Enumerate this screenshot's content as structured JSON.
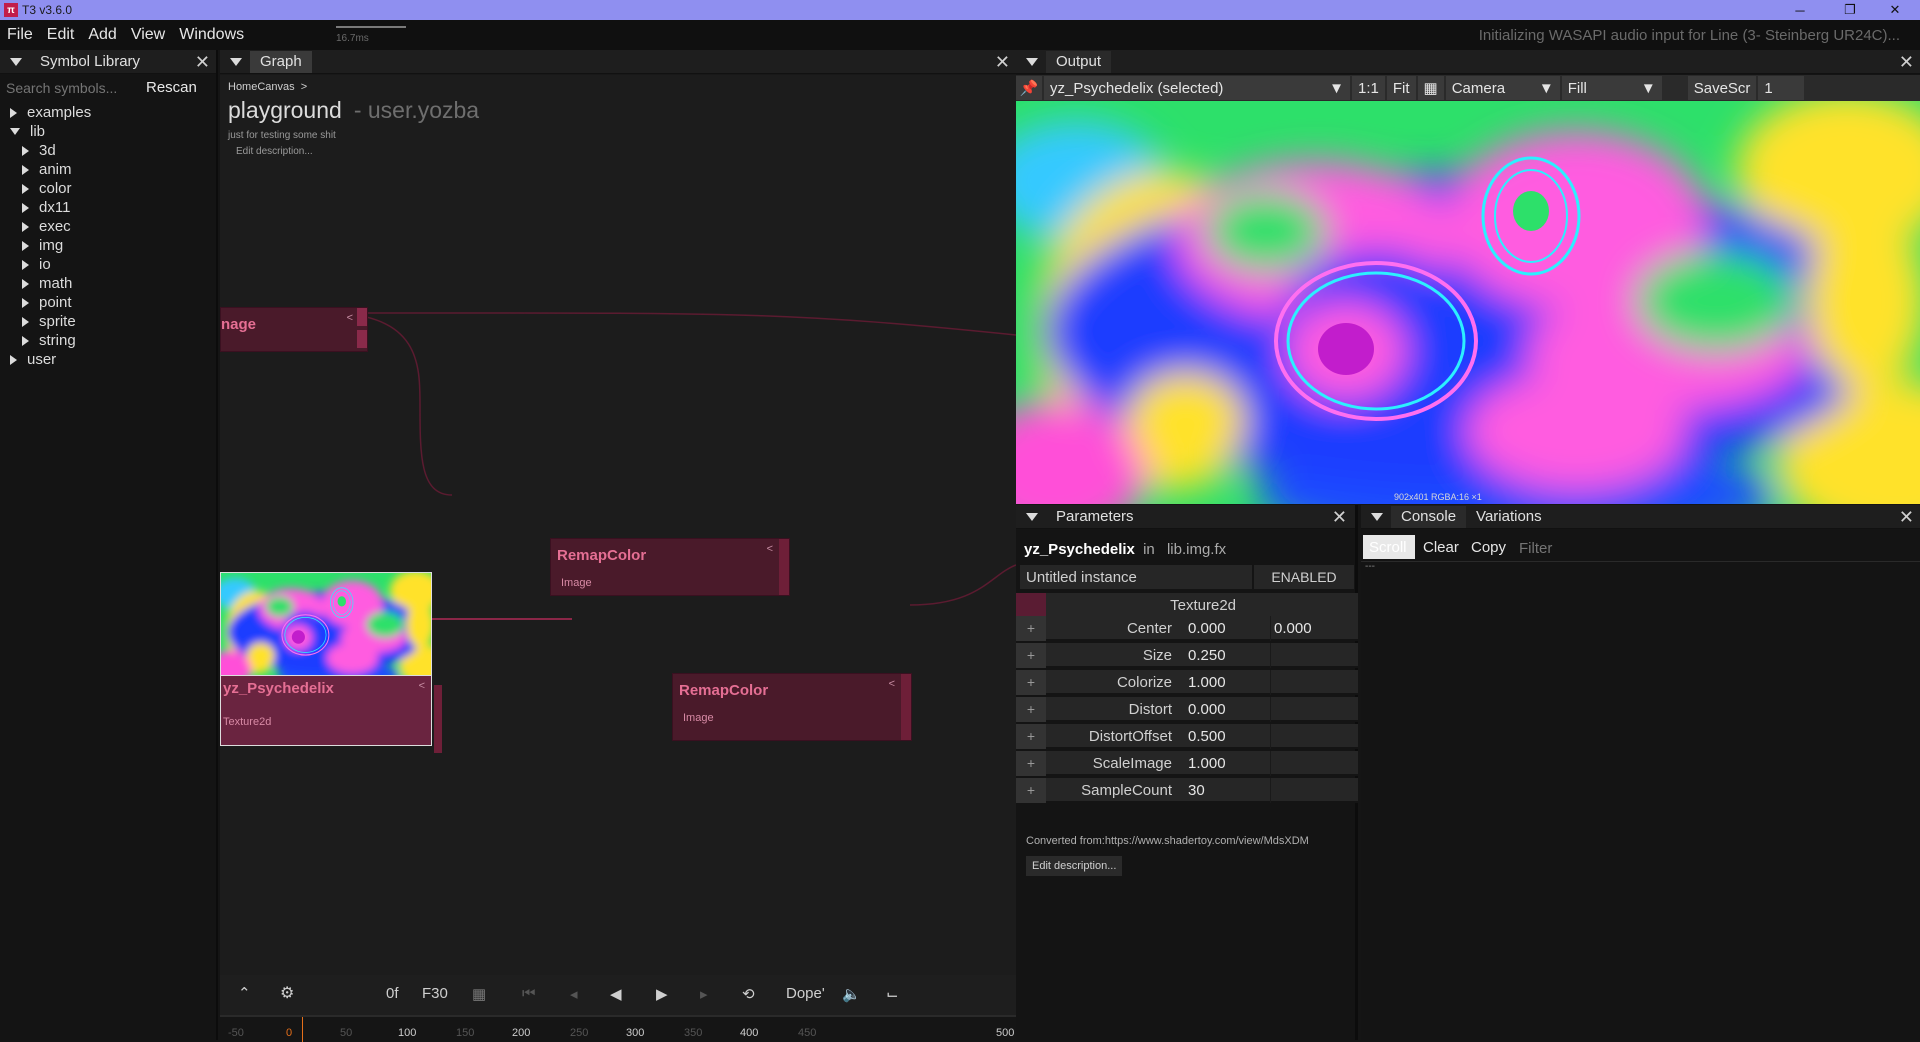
{
  "app": {
    "title": "T3 v3.6.0",
    "fps": "16.7ms",
    "status": "Initializing WASAPI audio input for  Line (3- Steinberg UR24C)..."
  },
  "menu": [
    "File",
    "Edit",
    "Add",
    "View",
    "Windows"
  ],
  "symbol_library": {
    "tab": "Symbol Library",
    "search_placeholder": "Search symbols...",
    "rescan": "Rescan",
    "tree": {
      "examples": "examples",
      "lib": "lib",
      "lib_children": [
        "3d",
        "anim",
        "color",
        "dx11",
        "exec",
        "img",
        "io",
        "math",
        "point",
        "sprite",
        "string"
      ],
      "user": "user"
    }
  },
  "graph": {
    "tab": "Graph",
    "breadcrumb": "HomeCanvas",
    "breadcrumb_sep": ">",
    "title": "playground",
    "namespace": "- user.yozba",
    "description": "just for testing some shit",
    "edit_description": "Edit description...",
    "nodes": {
      "image_partial": {
        "title": "nage",
        "arrow": "<"
      },
      "remap1": {
        "title": "RemapColor",
        "port": "Image",
        "arrow": "<"
      },
      "psyche": {
        "title": "yz_Psychedelix",
        "port": "Texture2d",
        "arrow": "<"
      },
      "remap2": {
        "title": "RemapColor",
        "port": "Image",
        "arrow": "<"
      }
    }
  },
  "timeline": {
    "frame": "0f",
    "fps": "F30",
    "mode": "Dope'",
    "ticks": [
      "-50",
      "0",
      "50",
      "100",
      "150",
      "200",
      "250",
      "300",
      "350",
      "400",
      "450",
      "500"
    ]
  },
  "output": {
    "tab": "Output",
    "selected": "yz_Psychedelix (selected)",
    "ratio": "1:1",
    "fit": "Fit",
    "camera": "Camera",
    "fill": "Fill",
    "save": "SaveScr",
    "save_num": "1",
    "info": "902x401  RGBA:16  ×1"
  },
  "parameters": {
    "tab": "Parameters",
    "symbol": "yz_Psychedelix",
    "in": "in",
    "namespace": "lib.img.fx",
    "instance": "Untitled instance",
    "enabled": "ENABLED",
    "output_type": "Texture2d",
    "rows": [
      {
        "name": "Center",
        "value": "0.000",
        "value2": "0.000"
      },
      {
        "name": "Size",
        "value": "0.250",
        "value2": ""
      },
      {
        "name": "Colorize",
        "value": "1.000",
        "value2": ""
      },
      {
        "name": "Distort",
        "value": "0.000",
        "value2": ""
      },
      {
        "name": "DistortOffset",
        "value": "0.500",
        "value2": ""
      },
      {
        "name": "ScaleImage",
        "value": "1.000",
        "value2": ""
      },
      {
        "name": "SampleCount",
        "value": "30",
        "value2": ""
      }
    ],
    "converted": "Converted from:https://www.shadertoy.com/view/MdsXDM",
    "edit_description": "Edit description..."
  },
  "console": {
    "tabs": [
      "Console",
      "Variations"
    ],
    "scroll": "Scroll",
    "clear": "Clear",
    "copy": "Copy",
    "filter_placeholder": "Filter",
    "log": "---"
  },
  "colors": {
    "accent": "#8f8ff0",
    "node": "#4a1a2a",
    "node_title": "#e56f94",
    "wire": "#6e1f38"
  }
}
